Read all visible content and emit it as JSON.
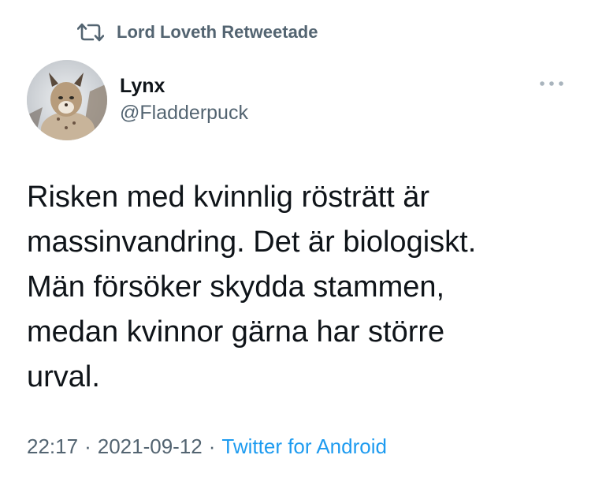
{
  "retweet": {
    "label": "Lord Loveth Retweetade",
    "icon": "retweet-icon"
  },
  "author": {
    "display_name": "Lynx",
    "handle": "@Fladderpuck",
    "avatar_icon": "lynx-avatar"
  },
  "more_icon": "more-options-icon",
  "tweet": {
    "text": "Risken med kvinnlig rösträtt är\nmassinvandring. Det är biologiskt.\nMän försöker skydda stammen,\nmedan kvinnor gärna har större\nurval."
  },
  "meta": {
    "time": "22:17",
    "separator": "·",
    "date": "2021-09-12",
    "client": "Twitter for Android"
  },
  "colors": {
    "text": "#0f1419",
    "secondary": "#536471",
    "link": "#1d9bf0"
  }
}
